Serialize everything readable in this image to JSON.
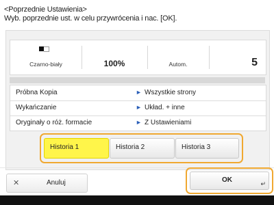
{
  "header": {
    "title": "<Poprzednie Ustawienia>",
    "subtitle": "Wyb. poprzednie ust. w celu przywrócenia i nac. [OK]."
  },
  "summary": {
    "color_mode": "Czarno-biały",
    "zoom": "100%",
    "paper": "Autom.",
    "copies": "5"
  },
  "settings": [
    {
      "name": "Próbna Kopia",
      "value": "Wszystkie strony"
    },
    {
      "name": "Wykańczanie",
      "value": "Układ. + inne"
    },
    {
      "name": "Oryginały o róż. formacie",
      "value": "Z Ustawieniami"
    }
  ],
  "history": {
    "items": [
      "Historia 1",
      "Historia 2",
      "Historia 3"
    ],
    "selected": "Historia 1"
  },
  "buttons": {
    "cancel": "Anuluj",
    "ok": "OK"
  },
  "icons": {
    "cancel": "close-icon",
    "ok": "enter-return-icon",
    "color_mode": "black-white-icon"
  },
  "colors": {
    "highlight": "#f0a830",
    "selected": "#fff54a",
    "arrow": "#2b5fb8"
  }
}
